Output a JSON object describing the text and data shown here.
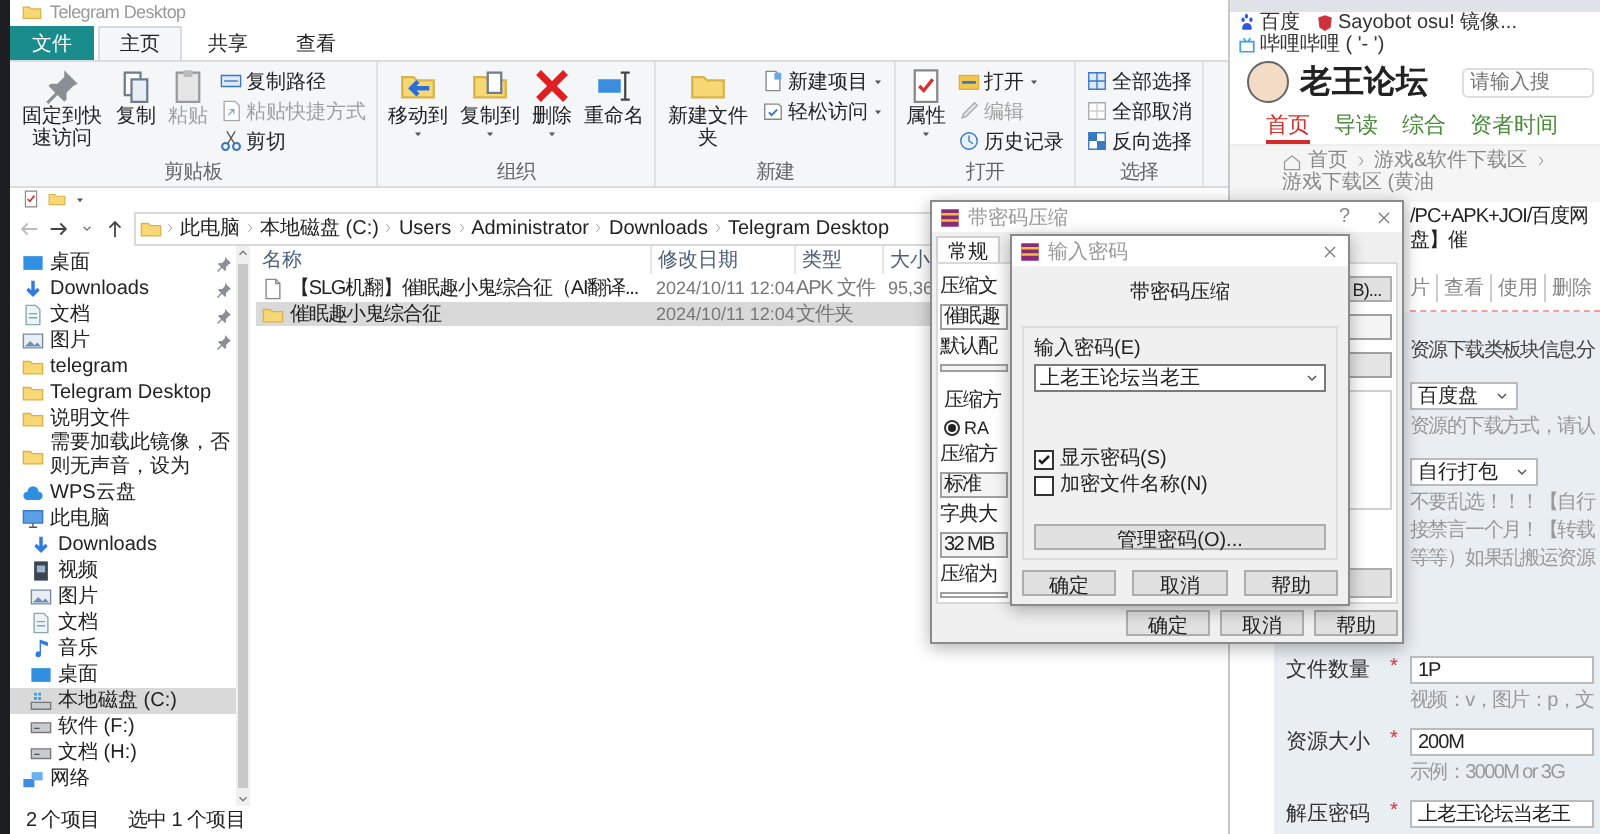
{
  "explorer": {
    "title": "Telegram Desktop",
    "ribbon_tabs": [
      {
        "label": "文件",
        "kind": "file",
        "selected": false
      },
      {
        "label": "主页",
        "kind": "tab",
        "selected": true
      },
      {
        "label": "共享",
        "kind": "tab",
        "selected": false
      },
      {
        "label": "查看",
        "kind": "tab",
        "selected": false
      }
    ],
    "ribbon_groups": [
      {
        "label": "剪贴板",
        "items": [
          {
            "kind": "big",
            "label": "固定到快速访问",
            "disabled": false,
            "dropdown": false
          },
          {
            "kind": "big",
            "label": "复制",
            "disabled": false,
            "dropdown": false
          },
          {
            "kind": "big",
            "label": "粘贴",
            "disabled": true,
            "dropdown": false
          },
          {
            "kind": "stack",
            "items": [
              {
                "label": "复制路径",
                "disabled": false,
                "dropdown": false
              },
              {
                "label": "粘贴快捷方式",
                "disabled": true,
                "dropdown": false
              },
              {
                "label": "剪切",
                "disabled": false,
                "dropdown": false
              }
            ]
          }
        ]
      },
      {
        "label": "组织",
        "items": [
          {
            "kind": "big",
            "label": "移动到",
            "disabled": false,
            "dropdown": true
          },
          {
            "kind": "big",
            "label": "复制到",
            "disabled": false,
            "dropdown": true
          },
          {
            "kind": "big",
            "label": "删除",
            "disabled": false,
            "dropdown": true
          },
          {
            "kind": "big",
            "label": "重命名",
            "disabled": false,
            "dropdown": false
          }
        ]
      },
      {
        "label": "新建",
        "items": [
          {
            "kind": "big",
            "label": "新建文件夹",
            "disabled": false,
            "dropdown": false
          },
          {
            "kind": "stack",
            "items": [
              {
                "label": "新建项目",
                "disabled": false,
                "dropdown": true
              },
              {
                "label": "轻松访问",
                "disabled": false,
                "dropdown": true
              }
            ]
          }
        ]
      },
      {
        "label": "打开",
        "items": [
          {
            "kind": "big",
            "label": "属性",
            "disabled": false,
            "dropdown": true
          },
          {
            "kind": "stack",
            "items": [
              {
                "label": "打开",
                "disabled": false,
                "dropdown": true
              },
              {
                "label": "编辑",
                "disabled": true,
                "dropdown": false
              },
              {
                "label": "历史记录",
                "disabled": false,
                "dropdown": false
              }
            ]
          }
        ]
      },
      {
        "label": "选择",
        "items": [
          {
            "kind": "stack",
            "items": [
              {
                "label": "全部选择",
                "disabled": false,
                "dropdown": false
              },
              {
                "label": "全部取消",
                "disabled": false,
                "dropdown": false
              },
              {
                "label": "反向选择",
                "disabled": false,
                "dropdown": false
              }
            ]
          }
        ]
      }
    ],
    "address": [
      "此电脑",
      "本地磁盘 (C:)",
      "Users",
      "Administrator",
      "Downloads",
      "Telegram Desktop"
    ],
    "nav": [
      {
        "label": "桌面",
        "pinned": true,
        "selected": false
      },
      {
        "label": "Downloads",
        "pinned": true,
        "selected": false
      },
      {
        "label": "文档",
        "pinned": true,
        "selected": false
      },
      {
        "label": "图片",
        "pinned": true,
        "selected": false
      },
      {
        "label": "telegram",
        "pinned": false,
        "selected": false
      },
      {
        "label": "Telegram Desktop",
        "pinned": false,
        "selected": false
      },
      {
        "label": "说明文件",
        "pinned": false,
        "selected": false
      },
      {
        "label": "需要加载此镜像，否则无声音，设为",
        "pinned": false,
        "selected": false
      },
      {
        "label": "WPS云盘",
        "pinned": false,
        "selected": false
      },
      {
        "label": "此电脑",
        "pinned": false,
        "selected": false,
        "children": [
          {
            "label": "Downloads",
            "selected": false
          },
          {
            "label": "视频",
            "selected": false
          },
          {
            "label": "图片",
            "selected": false
          },
          {
            "label": "文档",
            "selected": false
          },
          {
            "label": "音乐",
            "selected": false
          },
          {
            "label": "桌面",
            "selected": false
          },
          {
            "label": "本地磁盘 (C:)",
            "selected": true
          },
          {
            "label": "软件 (F:)",
            "selected": false
          },
          {
            "label": "文档 (H:)",
            "selected": false
          }
        ]
      },
      {
        "label": "网络",
        "pinned": false,
        "selected": false
      }
    ],
    "columns": [
      "名称",
      "修改日期",
      "类型",
      "大小"
    ],
    "files": [
      {
        "kind": "file",
        "name": "【SLG机翻】催眠趣小鬼综合征（AI翻译...",
        "date": "2024/10/11 12:04",
        "type": "APK 文件",
        "size": "95,36",
        "selected": false
      },
      {
        "kind": "folder",
        "name": "催眠趣小鬼综合征",
        "date": "2024/10/11 12:04",
        "type": "文件夹",
        "selected": true
      }
    ],
    "status": [
      "2 个项目",
      "选中 1 个项目"
    ]
  },
  "browser": {
    "bookmarks": [
      "百度",
      "Sayobot osu! 镜像...",
      "哔哩哔哩 ( '- ')"
    ],
    "site_name": "老王论坛",
    "search_placeholder": "请输入搜",
    "nav": [
      {
        "label": "首页",
        "selected": true
      },
      {
        "label": "导读",
        "selected": false
      },
      {
        "label": "综合",
        "selected": false
      },
      {
        "label": "资者时间",
        "selected": false
      }
    ],
    "breadcrumb": [
      "首页",
      "游戏&软件下载区",
      "游戏下载区 (黄油"
    ],
    "thread_title": "/PC+APK+JOI/百度网盘】催",
    "thread_actions": [
      "片",
      "查看",
      "使用",
      "删除"
    ],
    "form": {
      "notice": "资源下载类板块信息分",
      "rows": [
        {
          "kind": "select",
          "value": "百度盘",
          "hint": "资源的下载方式，请认"
        },
        {
          "kind": "select",
          "value": "自行打包",
          "hint_lines": [
            "不要乱选！！！【自行",
            "接禁言一个月！【转载",
            "等等）如果乱搬运资源"
          ]
        },
        {
          "kind": "input",
          "label": "文件数量",
          "required_mark": "*",
          "value": "1P",
          "hint": "视频：v，图片：p，文"
        },
        {
          "kind": "input",
          "label": "资源大小",
          "required_mark": "*",
          "value": "200M",
          "hint": "示例：3000M or 3G"
        },
        {
          "kind": "input",
          "label": "解压密码",
          "required_mark": "*",
          "value": "上老王论坛当老王"
        }
      ]
    }
  },
  "archive_dialog": {
    "title": "带密码压缩",
    "help": "?",
    "tabs": [
      {
        "label": "常规",
        "selected": true
      }
    ],
    "fragments": [
      {
        "kind": "label",
        "text": "压缩文"
      },
      {
        "kind": "field",
        "text": "催眠趣"
      },
      {
        "kind": "label",
        "text": "默认配"
      },
      {
        "kind": "combo"
      },
      {
        "kind": "group",
        "text": "压缩方"
      },
      {
        "kind": "radio",
        "text": "RA",
        "selected": true
      },
      {
        "kind": "label",
        "text": "压缩方"
      },
      {
        "kind": "combo",
        "text": "标准"
      },
      {
        "kind": "label",
        "text": "字典大"
      },
      {
        "kind": "combo",
        "text": "32 MB"
      },
      {
        "kind": "label",
        "text": "压缩为"
      },
      {
        "kind": "field"
      }
    ],
    "browse_button": "B)...",
    "buttons": [
      "确定",
      "取消",
      "帮助"
    ]
  },
  "password_dialog": {
    "title": "输入密码",
    "heading": "带密码压缩",
    "password_label": "输入密码(E)",
    "password": "上老王论坛当老王",
    "options": [
      {
        "label": "显示密码(S)",
        "checked": true
      },
      {
        "label": "加密文件名称(N)",
        "checked": false
      }
    ],
    "manage_button": "管理密码(O)...",
    "buttons": [
      "确定",
      "取消",
      "帮助"
    ]
  }
}
